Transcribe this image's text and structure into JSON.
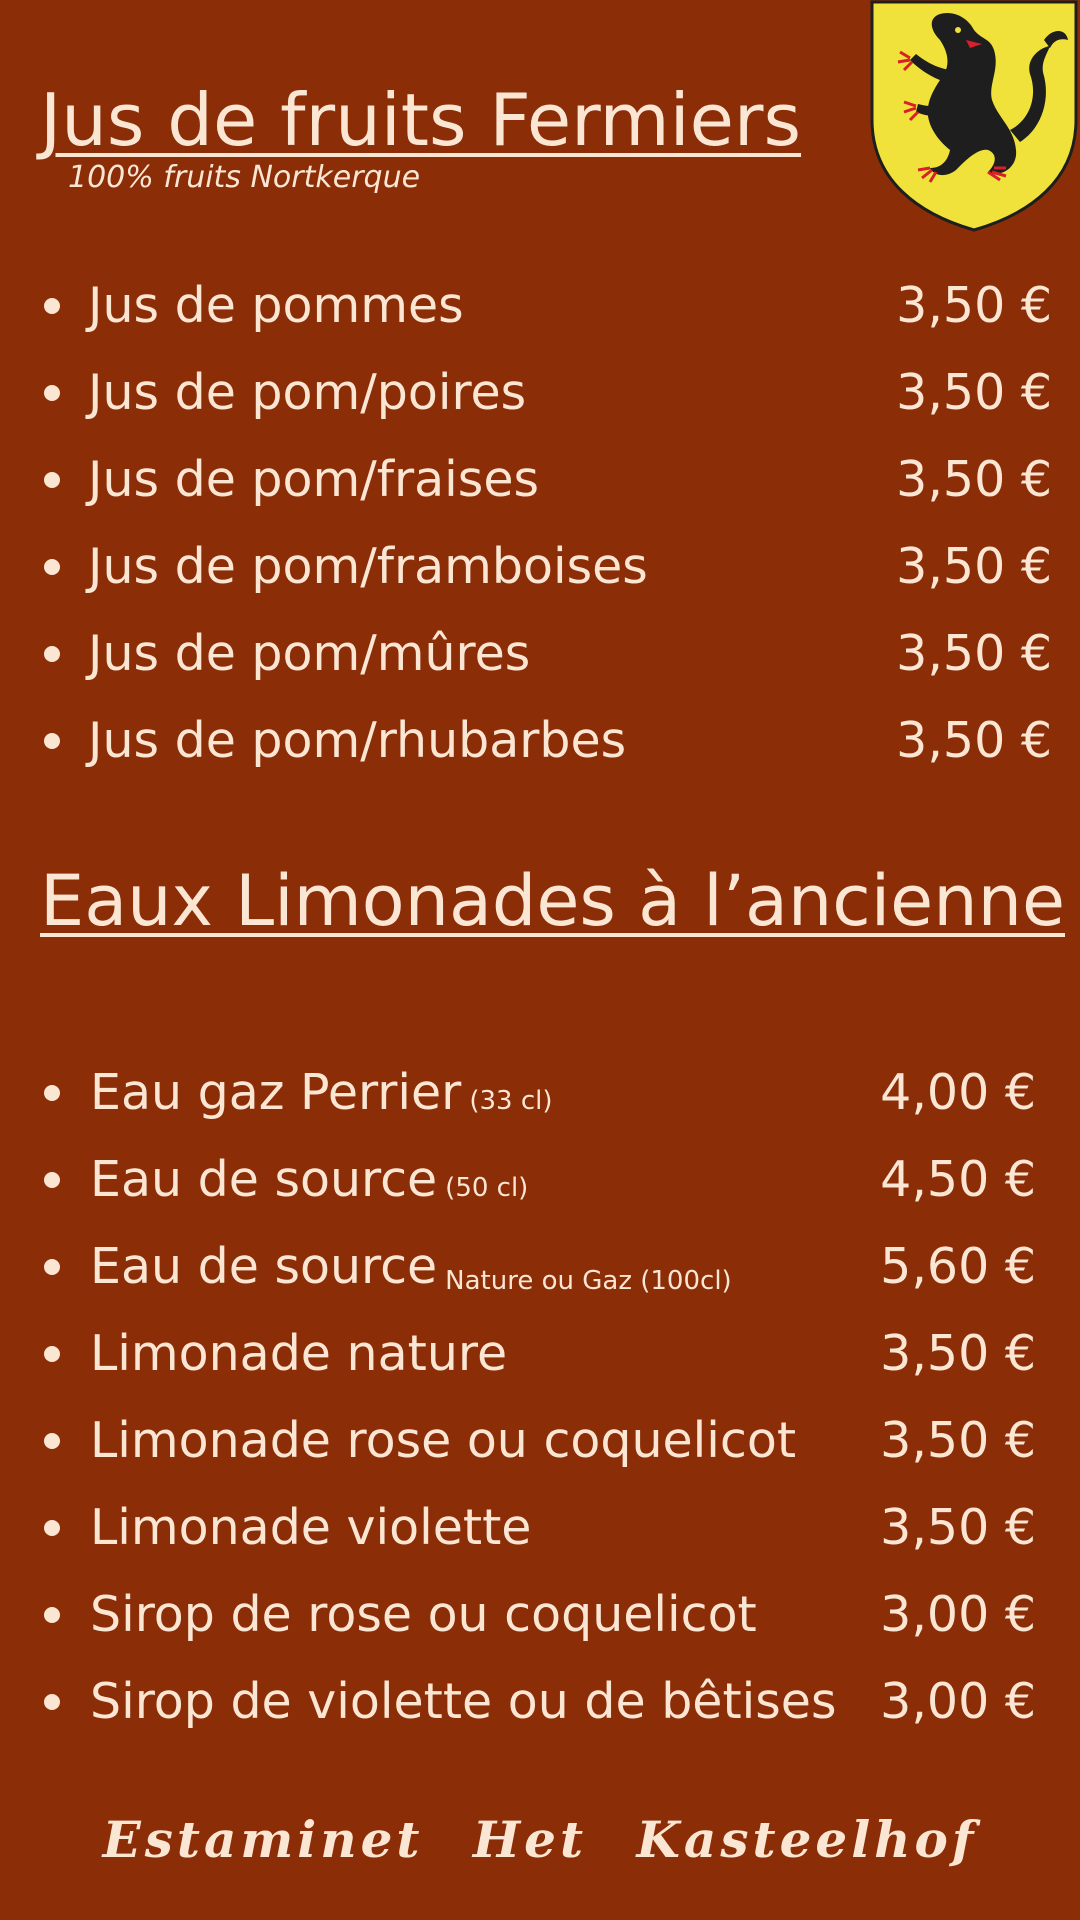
{
  "juice": {
    "title": "Jus de fruits Fermiers",
    "subtitle": "100% fruits Nortkerque",
    "items": [
      {
        "name": "Jus de pommes",
        "price": "3,50 €"
      },
      {
        "name": "Jus de pom/poires",
        "price": "3,50 €"
      },
      {
        "name": "Jus de pom/fraises",
        "price": "3,50 €"
      },
      {
        "name": "Jus de pom/framboises",
        "price": "3,50 €"
      },
      {
        "name": "Jus de pom/mûres",
        "price": "3,50 €"
      },
      {
        "name": "Jus de pom/rhubarbes",
        "price": "3,50 €"
      }
    ]
  },
  "water": {
    "title": "Eaux Limonades à l’ancienne",
    "items": [
      {
        "name": "Eau gaz Perrier",
        "note": "(33 cl)",
        "price": "4,00 €"
      },
      {
        "name": "Eau de source",
        "note": "(50 cl)",
        "price": "4,50 €"
      },
      {
        "name": "Eau de source",
        "note": "Nature ou Gaz (100cl)",
        "price": "5,60 €"
      },
      {
        "name": "Limonade nature",
        "price": "3,50 €"
      },
      {
        "name": "Limonade rose ou coquelicot",
        "price": "3,50 €"
      },
      {
        "name": "Limonade violette",
        "price": "3,50 €"
      },
      {
        "name": "Sirop de rose ou coquelicot",
        "price": "3,00 €"
      },
      {
        "name": "Sirop de violette ou de bêtises",
        "price": "3,00 €"
      }
    ]
  },
  "footer": "Estaminet  Het Kasteelhof",
  "logo": {
    "icon": "flanders-lion-crest-icon",
    "shield_color": "#f0e23a",
    "lion_color": "#1e1e1e",
    "claw_color": "#d8202a"
  },
  "colors": {
    "background": "#8b2e08",
    "text": "#fbe6d4"
  }
}
